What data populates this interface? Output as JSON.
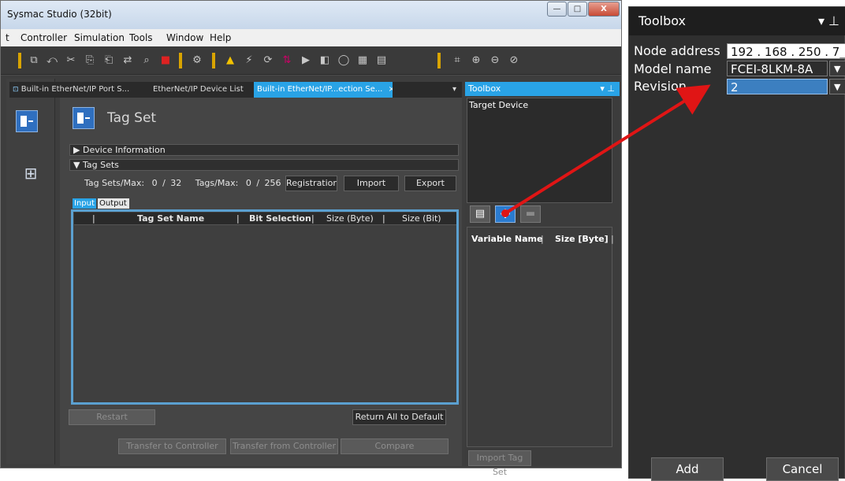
{
  "window": {
    "title": "Sysmac Studio (32bit)",
    "minimize_glyph": "—",
    "maximize_glyph": "□",
    "close_glyph": "X"
  },
  "menu": [
    "t",
    "Controller",
    "Simulation",
    "Tools",
    "Window",
    "Help"
  ],
  "tabs": [
    {
      "label": "Built-in EtherNet/IP Port S...",
      "active": false
    },
    {
      "label": "EtherNet/IP Device List",
      "active": false
    },
    {
      "label": "Built-in EtherNet/IP...ection Se...",
      "active": true
    }
  ],
  "tab_close_glyph": "×",
  "tab_dropdown_glyph": "▾",
  "page": {
    "title": "Tag Set",
    "device_information": "Device Information",
    "tag_sets": "Tag Sets",
    "tag_sets_label": "Tag Sets/Max:",
    "tag_sets_count": "0",
    "tag_sets_max": "32",
    "tags_label": "Tags/Max:",
    "tags_count": "0",
    "tags_max": "256",
    "separator": "/",
    "collapse_glyph": "▶",
    "expand_glyph": "▼",
    "registration_label": "Registratior",
    "import_label": "Import",
    "export_label": "Export",
    "input_tab": "Input",
    "output_tab": "Output",
    "columns": [
      "Tag Set Name",
      "Bit Selection",
      "Size (Byte)",
      "Size (Bit)"
    ],
    "restart_label": "Restart",
    "return_default_label": "Return All to Default",
    "transfer_to_label": "Transfer to Controller",
    "transfer_from_label": "Transfer from Controller",
    "compare_label": "Compare"
  },
  "toolbox": {
    "title": "Toolbox",
    "pin_glyph": "▾ ⊥",
    "target_device": "Target Device",
    "add_glyph": "+",
    "columns": [
      "Variable Name",
      "Size [Byte]"
    ],
    "import_tag_set": "Import Tag Set"
  },
  "zoom_toolbox": {
    "title": "Toolbox",
    "pin_glyph": "▾ ⊥",
    "node_address_label": "Node address",
    "node_address_value": "192 . 168 . 250 . 7_",
    "model_name_label": "Model name",
    "model_name_value": "FCEI-8LKM-8A",
    "revision_label": "Revision",
    "revision_value": "2",
    "dropdown_glyph": "▼",
    "add_label": "Add",
    "cancel_label": "Cancel"
  },
  "colors": {
    "accent_blue": "#29a3e6",
    "arrow_red": "#e01515",
    "warning_yellow": "#d9a400"
  },
  "icons": [
    "window-icon",
    "cut-icon",
    "copy-icon",
    "paste-icon",
    "find-icon",
    "warning-icon",
    "zoom-in-icon",
    "zoom-out-icon",
    "add-icon",
    "delete-icon"
  ]
}
